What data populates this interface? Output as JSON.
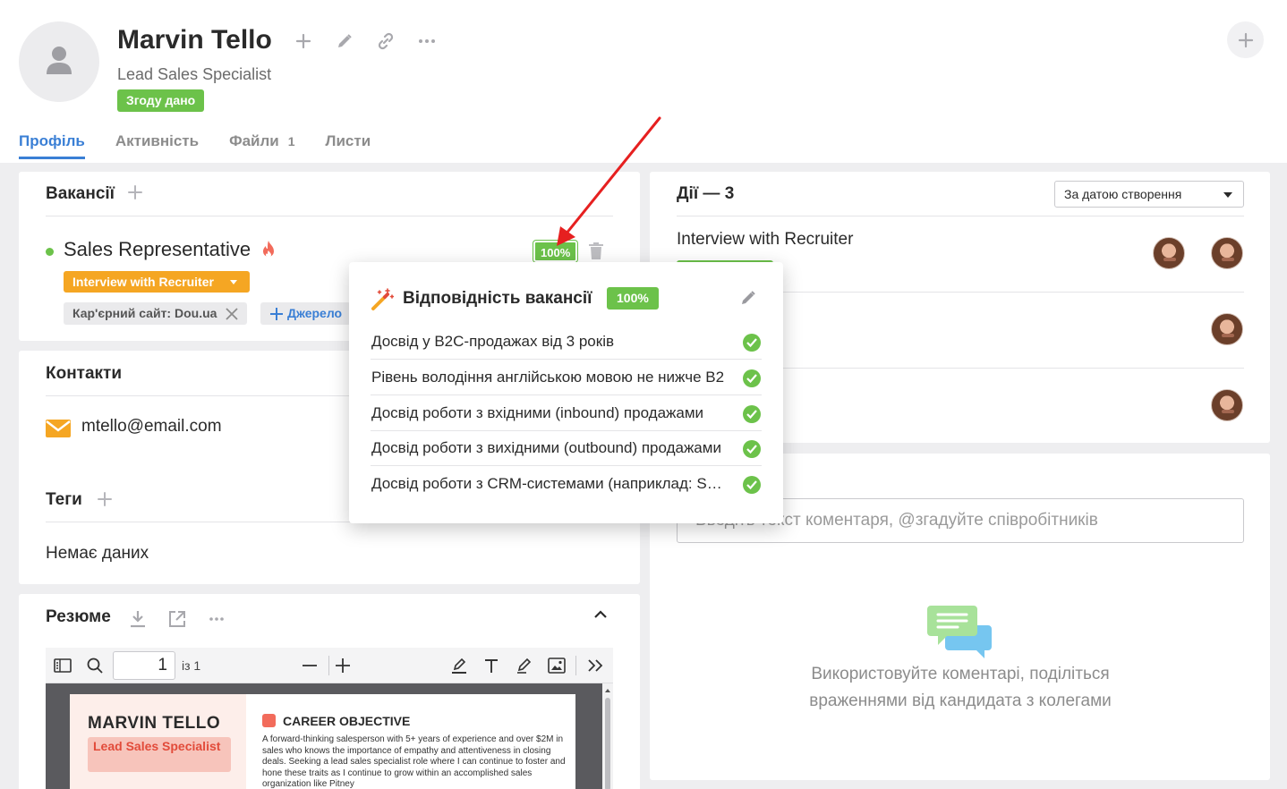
{
  "candidate": {
    "name": "Marvin Tello",
    "title": "Lead Sales Specialist",
    "consent_badge": "Згоду дано"
  },
  "tabs": [
    {
      "label": "Профіль",
      "active": true
    },
    {
      "label": "Активність"
    },
    {
      "label": "Файли",
      "count": "1"
    },
    {
      "label": "Листи"
    }
  ],
  "vacancies": {
    "title": "Вакансії",
    "item": {
      "name": "Sales Representative",
      "match_percent": "100%",
      "stage": "Interview with Recruiter",
      "source": "Кар'єрний сайт: Dou.ua",
      "add_source": "Джерело"
    }
  },
  "contacts": {
    "title": "Контакти",
    "email": "mtello@email.com"
  },
  "tags": {
    "title": "Теги",
    "empty": "Немає даних"
  },
  "resume": {
    "title": "Резюме",
    "page_current": "1",
    "page_total": "із 1",
    "doc": {
      "name": "MARVIN TELLO",
      "role": "Lead Sales Specialist",
      "section_title": "CAREER OBJECTIVE",
      "section_text": "A forward-thinking salesperson with 5+ years of experience and over $2M in sales who knows the importance of empathy and attentiveness in closing deals. Seeking a lead sales specialist role where I can continue to foster and hone these traits as I continue to grow within an accomplished sales organization like Pitney"
    }
  },
  "actions": {
    "title": "Дії — 3",
    "sort_label": "За датою створення",
    "first_title": "Interview with Recruiter"
  },
  "comments": {
    "placeholder": "Введіть текст коментаря, @згадуйте співробітників",
    "empty_text": "Використовуйте коментарі, поділіться враженнями від кандидата з колегами"
  },
  "match_popover": {
    "title": "Відповідність вакансії",
    "percent": "100%",
    "criteria": [
      "Досвід у B2C-продажах від 3 років",
      "Рівень володіння англійською мовою не нижче B2",
      "Досвід роботи з вхідними (inbound) продажами",
      "Досвід роботи з вихідними (outbound) продажами",
      "Досвід роботи з CRM-системами (наприклад: Salesforce)"
    ]
  },
  "colors": {
    "accent": "#3a7fd5",
    "success": "#6cc24a",
    "stage": "#f5a623",
    "annotation_arrow": "#e62020"
  },
  "icons": [
    "person-icon",
    "plus-icon",
    "pencil-icon",
    "link-icon",
    "more-icon",
    "fire-icon",
    "trash-icon",
    "close-icon",
    "email-icon",
    "download-icon",
    "external-link-icon",
    "chevron-up-icon",
    "sidebar-toggle-icon",
    "search-icon",
    "zoom-out-icon",
    "zoom-in-icon",
    "highlight-icon",
    "text-icon",
    "draw-icon",
    "image-icon",
    "double-chevron-icon",
    "magic-wand-icon",
    "check-icon",
    "chat-bubbles-icon"
  ]
}
